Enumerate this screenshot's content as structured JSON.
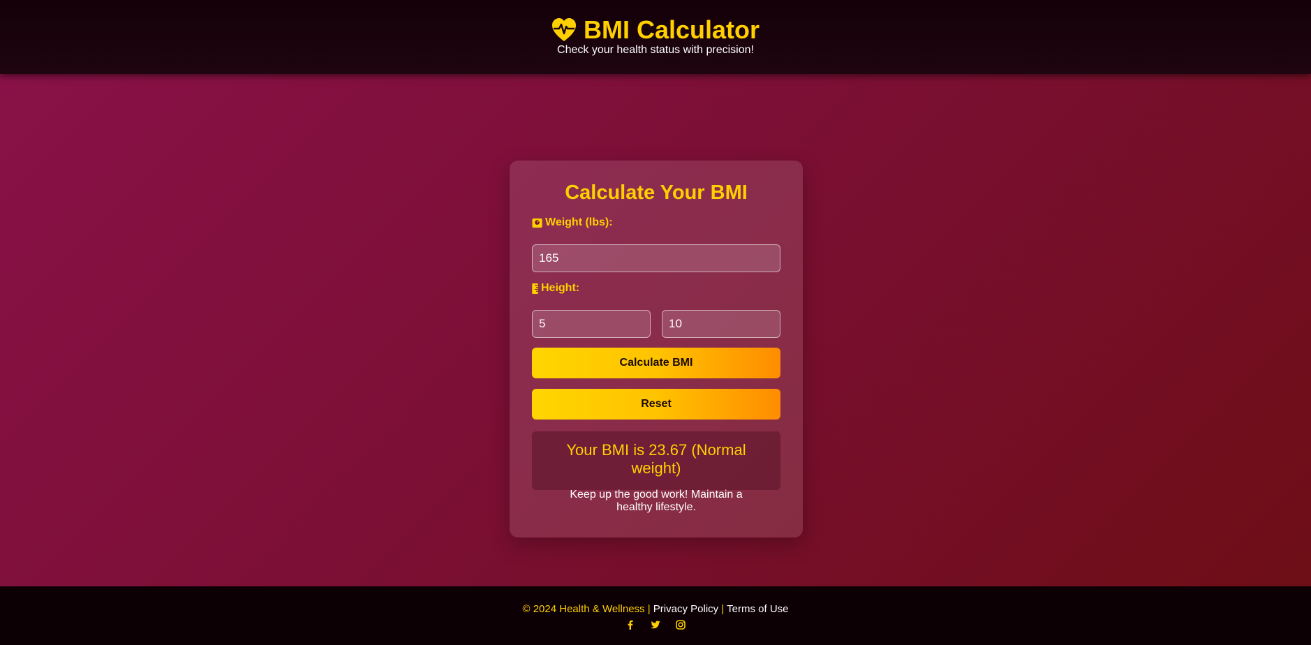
{
  "header": {
    "title": "BMI Calculator",
    "subtitle": "Check your health status with precision!",
    "icon": "heart-pulse-icon"
  },
  "card": {
    "title": "Calculate Your BMI",
    "weight_label": "Weight (lbs):",
    "weight_value": "165",
    "height_label": "Height:",
    "height_feet_value": "5",
    "height_inches_value": "10",
    "calculate_label": "Calculate BMI",
    "reset_label": "Reset",
    "result_text": "Your BMI is 23.67 (Normal weight)",
    "advice_text": "Keep up the good work! Maintain a healthy lifestyle."
  },
  "footer": {
    "copyright": "© 2024 Health & Wellness",
    "separator": "|",
    "privacy_label": "Privacy Policy",
    "terms_label": "Terms of Use",
    "socials": [
      "facebook-icon",
      "twitter-icon",
      "instagram-icon"
    ]
  },
  "colors": {
    "accent": "#ffd000",
    "button_gradient_start": "#ffd500",
    "button_gradient_end": "#ff8c00",
    "header_bg": "#140008",
    "footer_bg": "#0c0005"
  }
}
